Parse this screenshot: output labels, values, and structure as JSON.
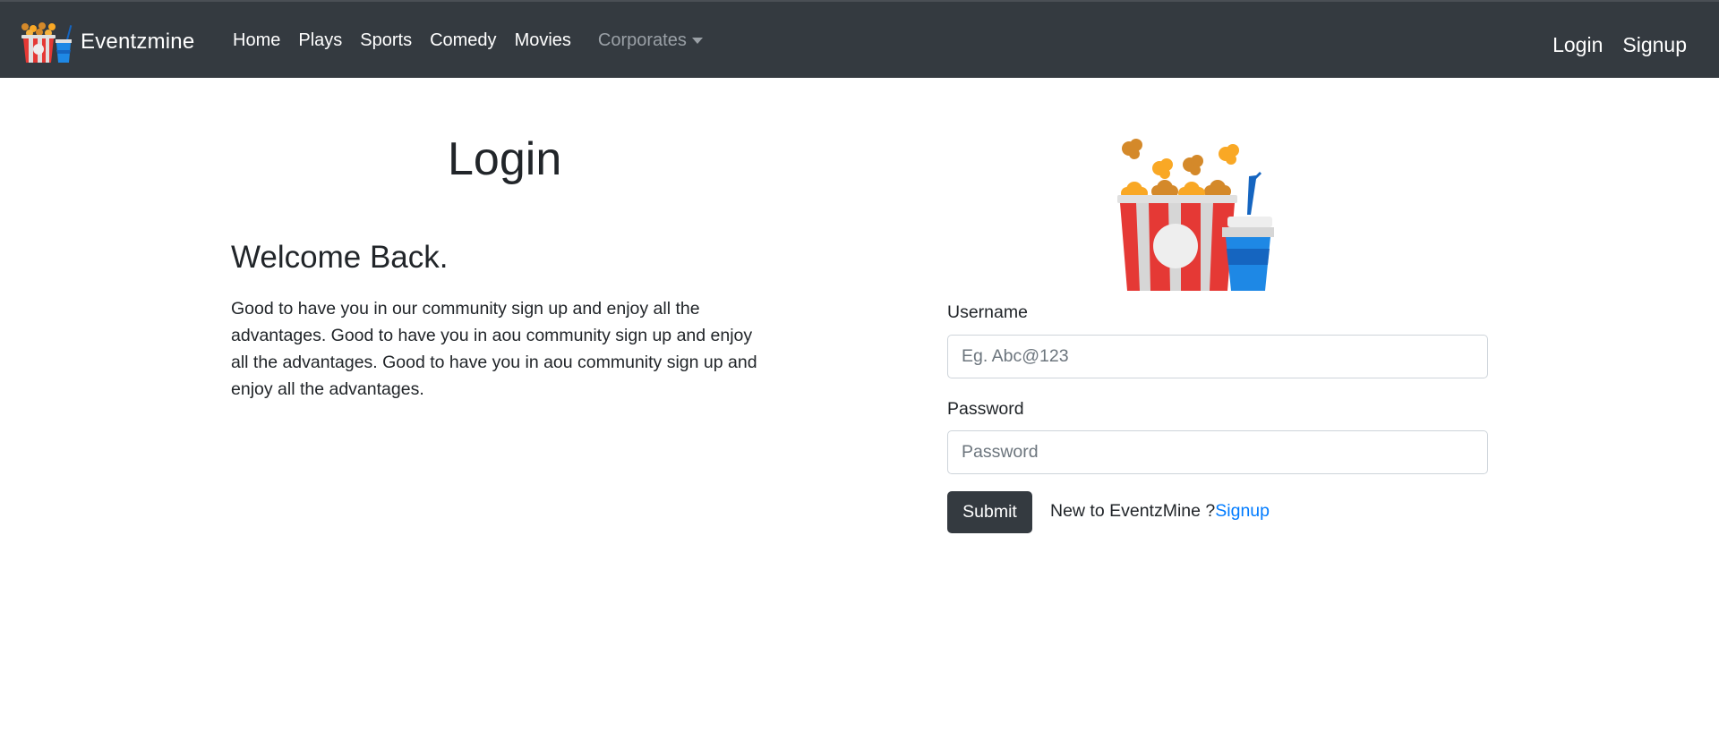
{
  "navbar": {
    "brand": "Eventzmine",
    "links": [
      "Home",
      "Plays",
      "Sports",
      "Comedy",
      "Movies"
    ],
    "dropdown": "Corporates",
    "right_links": [
      "Login",
      "Signup"
    ]
  },
  "left": {
    "title": "Login",
    "welcome": "Welcome Back.",
    "description": "Good to have you in our community sign up and enjoy all the advantages. Good to have you in aou community sign up and enjoy all the advantages. Good to have you in aou community sign up and enjoy all the advantages."
  },
  "form": {
    "username_label": "Username",
    "username_placeholder": "Eg. Abc@123",
    "username_value": "",
    "password_label": "Password",
    "password_placeholder": "Password",
    "password_value": "",
    "submit_label": "Submit",
    "new_to_text": "New to EventzMine ?",
    "signup_link": "Signup"
  },
  "colors": {
    "navbar_bg": "#343a40",
    "link_blue": "#007bff",
    "popcorn_red": "#e53935",
    "popcorn_yellow": "#f9a825",
    "cup_blue": "#1e88e5"
  },
  "icons": {
    "brand_logo": "popcorn-and-drink-icon",
    "hero_image": "popcorn-and-drink-illustration",
    "dropdown_caret": "caret-down-icon"
  }
}
